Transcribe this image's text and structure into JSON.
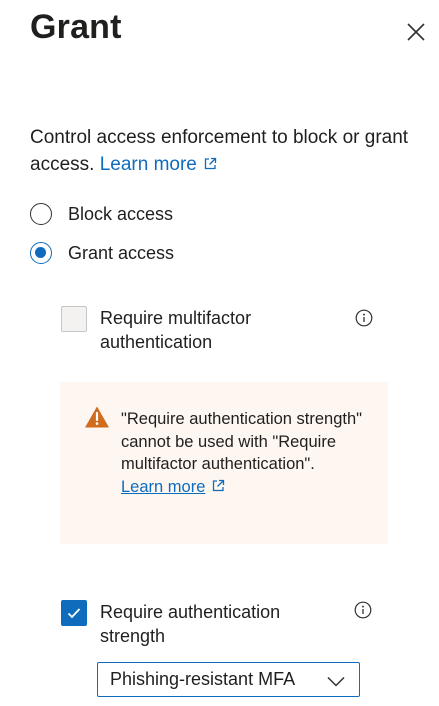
{
  "panel": {
    "title": "Grant"
  },
  "intro": {
    "text": "Control access enforcement to block or grant access.",
    "learn_more": "Learn more"
  },
  "access_options": [
    {
      "label": "Block access",
      "selected": false
    },
    {
      "label": "Grant access",
      "selected": true
    }
  ],
  "controls": {
    "mfa": {
      "label": "Require multifactor authentication",
      "checked": false
    },
    "auth_strength": {
      "label": "Require authentication strength",
      "checked": true
    }
  },
  "warning": {
    "text": "\"Require authentication strength\" cannot be used with \"Require multifactor authentication\".",
    "learn_more": "Learn more"
  },
  "strength_select": {
    "value": "Phishing-resistant MFA"
  },
  "colors": {
    "accent": "#0f6cbd",
    "warning_bg": "#fdf6f1",
    "warning_icon": "#d06c1e"
  }
}
